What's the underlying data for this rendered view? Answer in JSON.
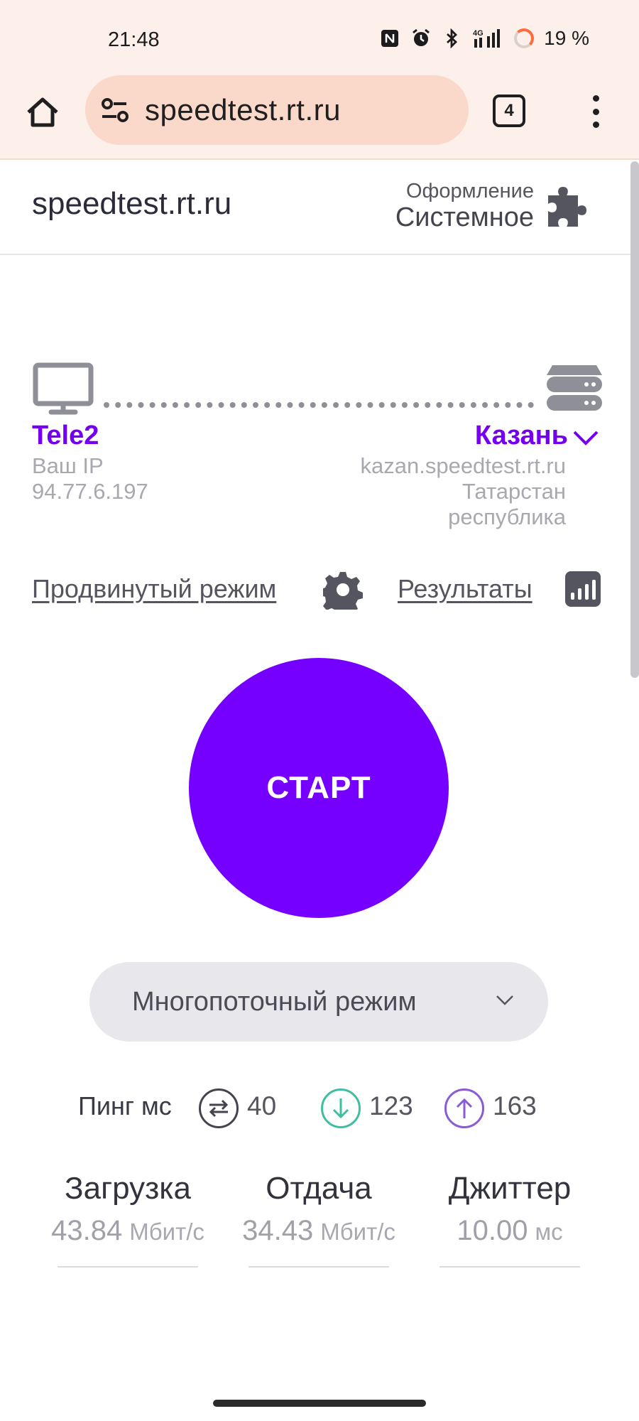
{
  "status_bar": {
    "time": "21:48",
    "network": "4G",
    "battery": "19 %",
    "icons": [
      "nfc-icon",
      "alarm-icon",
      "bluetooth-icon",
      "signal-icon",
      "battery-ring-icon"
    ]
  },
  "browser": {
    "url": "speedtest.rt.ru",
    "tab_count": "4"
  },
  "header": {
    "logo": "speedtest.rt.ru",
    "theme_label": "Оформление",
    "theme_value": "Системное"
  },
  "connection": {
    "isp": "Tele2",
    "ip_label": "Ваш IP",
    "ip": "94.77.6.197",
    "server_city": "Казань",
    "server_host": "kazan.speedtest.rt.ru",
    "server_region_line1": "Татарстан",
    "server_region_line2": "республика"
  },
  "links": {
    "advanced_mode": "Продвинутый режим",
    "results": "Результаты"
  },
  "start_button": "СТАРТ",
  "mode_select": {
    "value": "Многопоточный режим"
  },
  "ping": {
    "label": "Пинг мс",
    "idle": "40",
    "download": "123",
    "upload": "163"
  },
  "metrics": {
    "download": {
      "title": "Загрузка",
      "value": "43.84",
      "unit": "Мбит/с"
    },
    "upload": {
      "title": "Отдача",
      "value": "34.43",
      "unit": "Мбит/с"
    },
    "jitter": {
      "title": "Джиттер",
      "value": "10.00",
      "unit": "мс"
    }
  },
  "colors": {
    "accent": "#7500FF",
    "chrome_bg": "#FDF0EA",
    "download_ping": "#3FBF9F",
    "upload_ping": "#8A5BD6"
  }
}
